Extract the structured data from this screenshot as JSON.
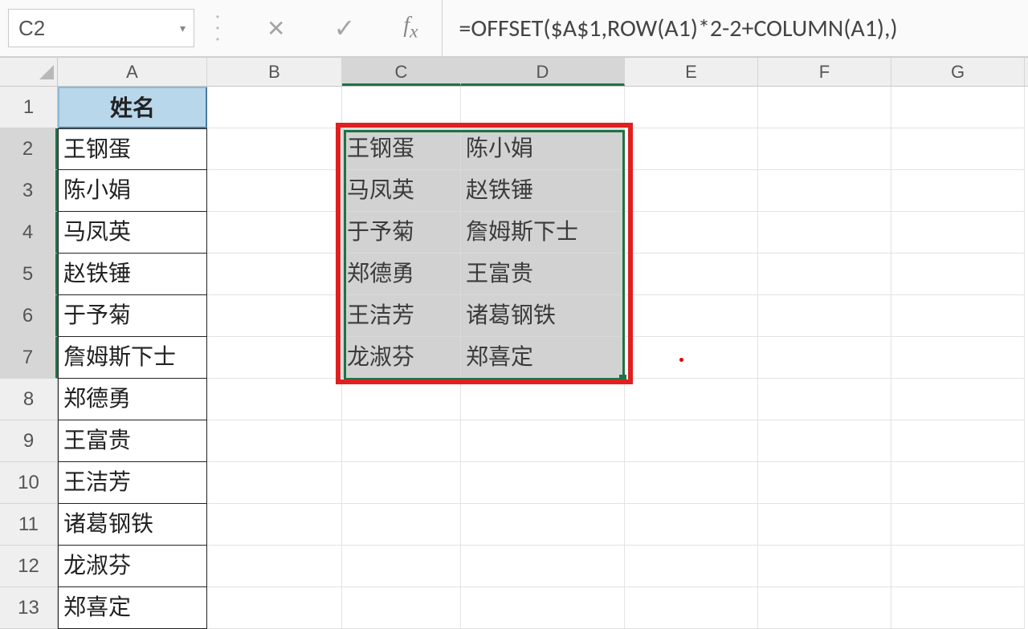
{
  "nameBox": "C2",
  "formula": "=OFFSET($A$1,ROW(A1)*2-2+COLUMN(A1),)",
  "columns": [
    "A",
    "B",
    "C",
    "D",
    "E",
    "F",
    "G"
  ],
  "headerA": "姓名",
  "colA": [
    "王钢蛋",
    "陈小娟",
    "马凤英",
    "赵铁锤",
    "于予菊",
    "詹姆斯下士",
    "郑德勇",
    "王富贵",
    "王洁芳",
    "诸葛钢铁",
    "龙淑芬",
    "郑喜定"
  ],
  "resultC": [
    "王钢蛋",
    "马凤英",
    "于予菊",
    "郑德勇",
    "王洁芳",
    "龙淑芬"
  ],
  "resultD": [
    "陈小娟",
    "赵铁锤",
    "詹姆斯下士",
    "王富贵",
    "诸葛钢铁",
    "郑喜定"
  ],
  "chart_data": {
    "type": "table",
    "title": "OFFSET formula reshaping single column into two columns",
    "source_column": [
      "王钢蛋",
      "陈小娟",
      "马凤英",
      "赵铁锤",
      "于予菊",
      "詹姆斯下士",
      "郑德勇",
      "王富贵",
      "王洁芳",
      "诸葛钢铁",
      "龙淑芬",
      "郑喜定"
    ],
    "result_table": [
      [
        "王钢蛋",
        "陈小娟"
      ],
      [
        "马凤英",
        "赵铁锤"
      ],
      [
        "于予菊",
        "詹姆斯下士"
      ],
      [
        "郑德勇",
        "王富贵"
      ],
      [
        "王洁芳",
        "诸葛钢铁"
      ],
      [
        "龙淑芬",
        "郑喜定"
      ]
    ],
    "formula": "=OFFSET($A$1,ROW(A1)*2-2+COLUMN(A1),)"
  }
}
